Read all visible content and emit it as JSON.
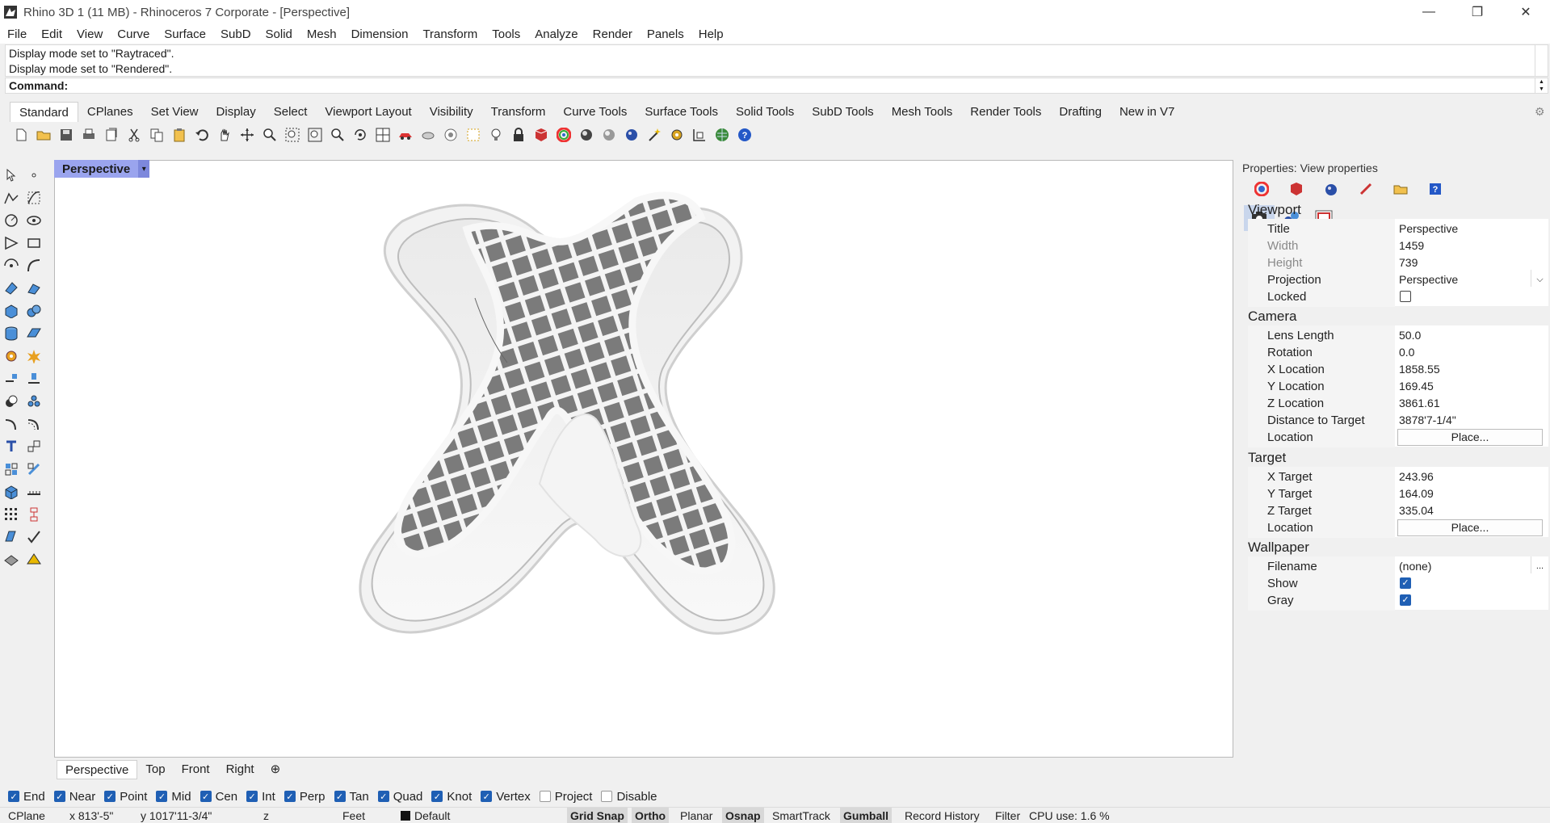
{
  "window": {
    "title": "Rhino 3D 1 (11 MB) - Rhinoceros 7 Corporate - [Perspective]",
    "minimize": "—",
    "maximize": "❐",
    "close": "✕"
  },
  "menu": [
    "File",
    "Edit",
    "View",
    "Curve",
    "Surface",
    "SubD",
    "Solid",
    "Mesh",
    "Dimension",
    "Transform",
    "Tools",
    "Analyze",
    "Render",
    "Panels",
    "Help"
  ],
  "history": {
    "line1": "Display mode set to \"Raytraced\".",
    "line2": "Display mode set to \"Rendered\"."
  },
  "command": {
    "label": "Command:"
  },
  "toolbar_tabs": [
    "Standard",
    "CPlanes",
    "Set View",
    "Display",
    "Select",
    "Viewport Layout",
    "Visibility",
    "Transform",
    "Curve Tools",
    "Surface Tools",
    "Solid Tools",
    "SubD Tools",
    "Mesh Tools",
    "Render Tools",
    "Drafting",
    "New in V7"
  ],
  "toolbar_icons": [
    "new-icon",
    "open-icon",
    "save-icon",
    "print-icon",
    "import-icon",
    "cut-icon",
    "copy-icon",
    "paste-icon",
    "undo-icon",
    "pan-icon",
    "rotate-view-icon",
    "zoom-icon",
    "zoom-window-icon",
    "zoom-extents-icon",
    "zoom-selected-icon",
    "zoom-dynamic-icon",
    "viewport-grid-icon",
    "car-icon",
    "hide-icon",
    "show-icon",
    "select-icon",
    "light-icon",
    "lock-icon",
    "material-icon",
    "color-wheel-icon",
    "shade-icon",
    "ghost-icon",
    "render-icon",
    "wand-icon",
    "options-icon",
    "snapshot-icon",
    "globe-icon",
    "help-icon"
  ],
  "viewport": {
    "label": "Perspective",
    "dropdown": "▾"
  },
  "view_tabs": [
    "Perspective",
    "Top",
    "Front",
    "Right",
    "⊕"
  ],
  "properties": {
    "header": "Properties: View properties",
    "sections": {
      "viewport": "Viewport",
      "camera": "Camera",
      "target": "Target",
      "wallpaper": "Wallpaper"
    },
    "viewport": {
      "title_lbl": "Title",
      "title_val": "Perspective",
      "width_lbl": "Width",
      "width_val": "1459",
      "height_lbl": "Height",
      "height_val": "739",
      "projection_lbl": "Projection",
      "projection_val": "Perspective",
      "locked_lbl": "Locked"
    },
    "camera": {
      "lens_lbl": "Lens Length",
      "lens_val": "50.0",
      "rotation_lbl": "Rotation",
      "rotation_val": "0.0",
      "xloc_lbl": "X Location",
      "xloc_val": "1858.55",
      "yloc_lbl": "Y Location",
      "yloc_val": "169.45",
      "zloc_lbl": "Z Location",
      "zloc_val": "3861.61",
      "dist_lbl": "Distance to Target",
      "dist_val": "3878'7-1/4\"",
      "loc_lbl": "Location",
      "loc_btn": "Place..."
    },
    "target": {
      "xt_lbl": "X Target",
      "xt_val": "243.96",
      "yt_lbl": "Y Target",
      "yt_val": "164.09",
      "zt_lbl": "Z Target",
      "zt_val": "335.04",
      "loc_lbl": "Location",
      "loc_btn": "Place..."
    },
    "wallpaper": {
      "file_lbl": "Filename",
      "file_val": "(none)",
      "file_btn": "...",
      "show_lbl": "Show",
      "show_checked": true,
      "gray_lbl": "Gray",
      "gray_checked": true
    }
  },
  "osnaps": [
    {
      "label": "End",
      "checked": true
    },
    {
      "label": "Near",
      "checked": true
    },
    {
      "label": "Point",
      "checked": true
    },
    {
      "label": "Mid",
      "checked": true
    },
    {
      "label": "Cen",
      "checked": true
    },
    {
      "label": "Int",
      "checked": true
    },
    {
      "label": "Perp",
      "checked": true
    },
    {
      "label": "Tan",
      "checked": true
    },
    {
      "label": "Quad",
      "checked": true
    },
    {
      "label": "Knot",
      "checked": true
    },
    {
      "label": "Vertex",
      "checked": true
    },
    {
      "label": "Project",
      "checked": false
    },
    {
      "label": "Disable",
      "checked": false
    }
  ],
  "status": {
    "cplane": "CPlane",
    "x": "x 813'-5\"",
    "y": "y 1017'11-3/4\"",
    "z": "z",
    "units": "Feet",
    "layer": "Default",
    "grid_snap": "Grid Snap",
    "ortho": "Ortho",
    "planar": "Planar",
    "osnap": "Osnap",
    "smarttrack": "SmartTrack",
    "gumball": "Gumball",
    "record_history": "Record History",
    "filter": "Filter",
    "cpu": "CPU use: 1.6 %"
  },
  "colors": {
    "viewport_label": "#9aa4ee",
    "check": "#1f5fb4"
  }
}
